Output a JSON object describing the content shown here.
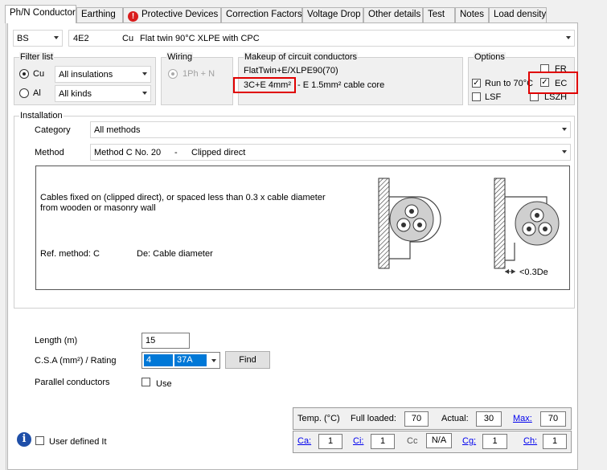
{
  "tabs": [
    {
      "label": "Ph/N Conductor",
      "active": true
    },
    {
      "label": "Earthing"
    },
    {
      "label": "Protective Devices",
      "warning": true
    },
    {
      "label": "Correction Factors"
    },
    {
      "label": "Voltage Drop"
    },
    {
      "label": "Other details"
    },
    {
      "label": "Test"
    },
    {
      "label": "Notes"
    },
    {
      "label": "Load density"
    }
  ],
  "cable": {
    "standard": "BS",
    "code": "4E2",
    "material": "Cu",
    "description": "Flat twin 90°C XLPE with CPC"
  },
  "filter_list": {
    "title": "Filter list",
    "cu_label": "Cu",
    "al_label": "Al",
    "insulation": "All insulations",
    "kinds": "All kinds"
  },
  "wiring": {
    "title": "Wiring",
    "option": "1Ph + N"
  },
  "makeup": {
    "title": "Makeup of circuit conductors",
    "line1": "FlatTwin+E/XLPE90(70)",
    "line2_part1": "3C+E 4mm²",
    "line2_part2": "- E 1.5mm² cable core"
  },
  "options": {
    "title": "Options",
    "fr": "FR",
    "run70": "Run to 70°C",
    "ec": "EC",
    "lsf": "LSF",
    "lszh": "LSZH"
  },
  "installation": {
    "title": "Installation",
    "category_label": "Category",
    "category_value": "All methods",
    "method_label": "Method",
    "method_value": "Method C No. 20",
    "method_sep": "-",
    "method_desc": "Clipped direct",
    "description_line1": "Cables fixed on (clipped direct), or spaced less than 0.3 x cable diameter",
    "description_line2": "from wooden or masonry wall",
    "ref_method": "Ref. method: C",
    "de_note": "De: Cable diameter",
    "diagram_label": "<0.3De"
  },
  "length": {
    "label": "Length (m)",
    "value": "15"
  },
  "csa": {
    "label": "C.S.A (mm²) / Rating",
    "size": "4",
    "rating": "37A",
    "find_label": "Find"
  },
  "parallel": {
    "label": "Parallel conductors",
    "use_label": "Use"
  },
  "temp": {
    "label": "Temp. (°C)",
    "full_loaded_label": "Full loaded:",
    "full_loaded": "70",
    "actual_label": "Actual:",
    "actual": "30",
    "max_label": "Max:",
    "max": "70"
  },
  "factors": {
    "ca_label": "Ca:",
    "ca": "1",
    "ci_label": "Ci:",
    "ci": "1",
    "cc_label": "Cc",
    "cc": "N/A",
    "cg_label": "Cg:",
    "cg": "1",
    "ch_label": "Ch:",
    "ch": "1"
  },
  "user_defined": "User defined It"
}
